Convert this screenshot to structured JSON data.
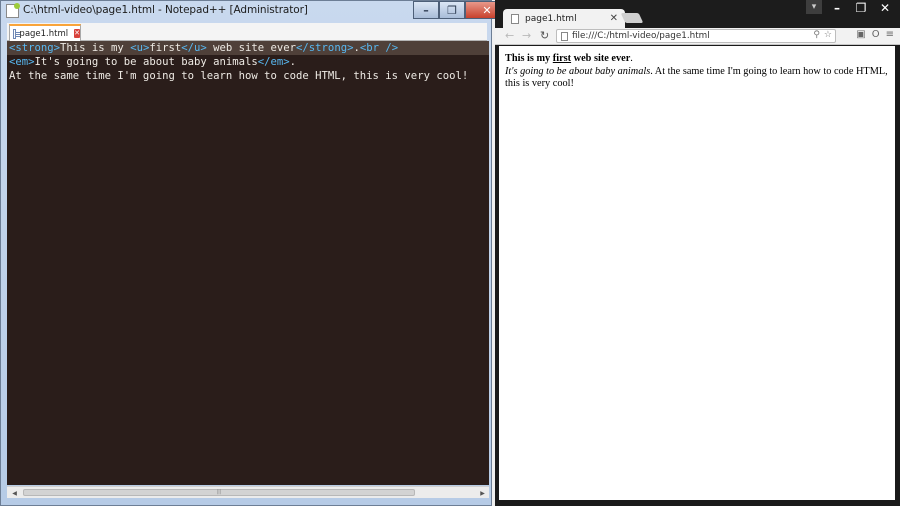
{
  "notepad": {
    "title": "C:\\html-video\\page1.html - Notepad++ [Administrator]",
    "tab_label": "page1.html",
    "window_buttons": {
      "minimize": "–",
      "maximize": "❐",
      "close": "✕"
    },
    "code": {
      "line1": {
        "open_strong": "<strong>",
        "text_a": "This is my ",
        "open_u": "<u>",
        "text_b": "first",
        "close_u": "</u>",
        "text_c": " web site ever",
        "close_strong": "</strong>",
        "dot": ".",
        "br": "<br />"
      },
      "line2": {
        "open_em": "<em>",
        "text": "It's going to be about baby animals",
        "close_em": "</em>",
        "dot": "."
      },
      "line3": {
        "text": "At the same time I'm going to learn how to code HTML, this is very cool!"
      }
    },
    "scroll_grip": "|||"
  },
  "chrome": {
    "tab_title": "page1.html",
    "tab_close": "✕",
    "url": "file:///C:/html-video/page1.html",
    "window_buttons": {
      "minimize": "–",
      "maximize": "❐",
      "close": "✕"
    },
    "content": {
      "strong_a": "This is my ",
      "underline": "first",
      "strong_b": " web site ever",
      "dot1": ".",
      "em": "It's going to be about baby animals",
      "rest": ". At the same time I'm going to learn how to code HTML, this is very cool!"
    }
  },
  "icons": {
    "back": "←",
    "forward": "→",
    "reload": "↻",
    "zoom": "⚲",
    "star": "☆",
    "menu": "≡"
  }
}
